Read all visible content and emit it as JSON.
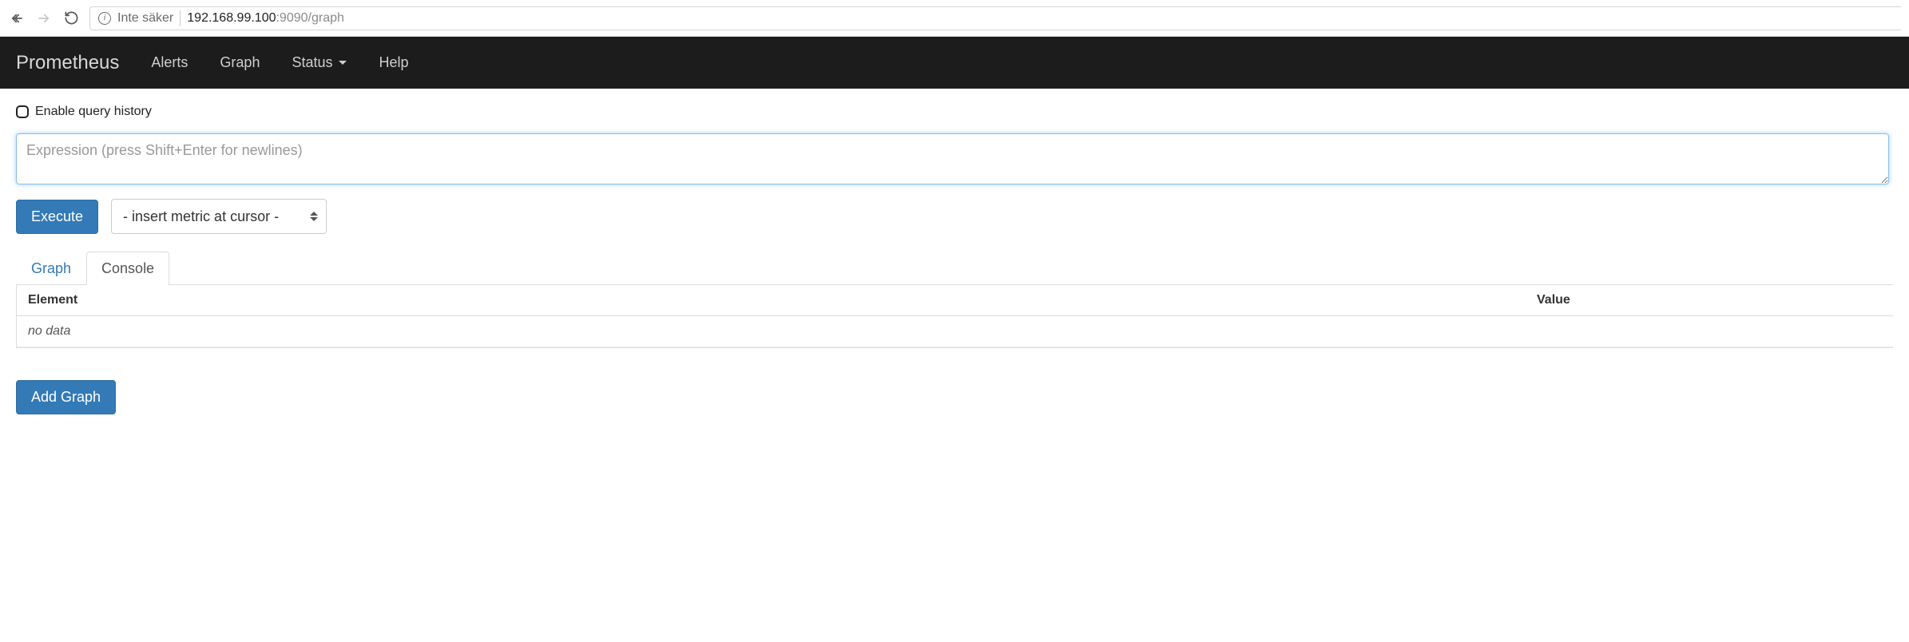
{
  "browser": {
    "secure_label": "Inte säker",
    "url_host": "192.168.99.100",
    "url_port": ":9090",
    "url_path": "/graph"
  },
  "navbar": {
    "brand": "Prometheus",
    "items": [
      {
        "label": "Alerts"
      },
      {
        "label": "Graph"
      },
      {
        "label": "Status",
        "dropdown": true
      },
      {
        "label": "Help"
      }
    ]
  },
  "query": {
    "history_label": "Enable query history",
    "expr_placeholder": "Expression (press Shift+Enter for newlines)",
    "expr_value": "",
    "execute_label": "Execute",
    "metric_select_placeholder": "- insert metric at cursor -"
  },
  "tabs": {
    "graph": "Graph",
    "console": "Console",
    "active": "console"
  },
  "table": {
    "columns": {
      "element": "Element",
      "value": "Value"
    },
    "empty": "no data"
  },
  "add_graph_label": "Add Graph"
}
